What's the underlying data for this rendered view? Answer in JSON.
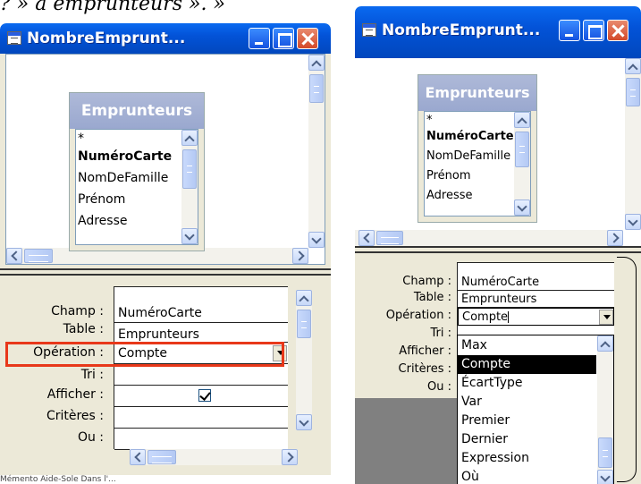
{
  "caption": "? » à emprunteurs ». »",
  "footer_note": "Mémento Aide-Sole Dans l'...",
  "left_window": {
    "title": "NombreEmprunt...",
    "table": {
      "name": "Emprunteurs",
      "fields": [
        "*",
        "NuméroCarte",
        "NomDeFamille",
        "Prénom",
        "Adresse"
      ]
    },
    "grid": {
      "labels": [
        "Champ :",
        "Table :",
        "Opération :",
        "Tri :",
        "Afficher :",
        "Critères :",
        "Ou :"
      ],
      "champ": "NuméroCarte",
      "table": "Emprunteurs",
      "operation": "Compte",
      "tri": "",
      "afficher_checked": true,
      "criteres": "",
      "ou": ""
    },
    "highlight_color": "#e8381a"
  },
  "right_window": {
    "title": "NombreEmprunt...",
    "table": {
      "name": "Emprunteurs",
      "fields": [
        "*",
        "NuméroCarte",
        "NomDeFamille",
        "Prénom",
        "Adresse"
      ]
    },
    "grid": {
      "labels": [
        "Champ :",
        "Table :",
        "Opération :",
        "Tri :",
        "Afficher :",
        "Critères :",
        "Ou :"
      ],
      "champ": "NuméroCarte",
      "table": "Emprunteurs",
      "operation": "Compte"
    },
    "dropdown_options": [
      "Max",
      "Compte",
      "ÉcartType",
      "Var",
      "Premier",
      "Dernier",
      "Expression",
      "Où"
    ],
    "dropdown_selected": "Compte"
  },
  "colors": {
    "titlebar": "#0353d8",
    "window_bg": "#ece9d8",
    "close_button": "#d44a2a"
  },
  "icons": [
    "window-icon",
    "minimize-icon",
    "maximize-icon",
    "close-icon",
    "scroll-up-icon",
    "scroll-down-icon",
    "scroll-left-icon",
    "scroll-right-icon",
    "dropdown-arrow-icon",
    "checkmark-icon"
  ]
}
